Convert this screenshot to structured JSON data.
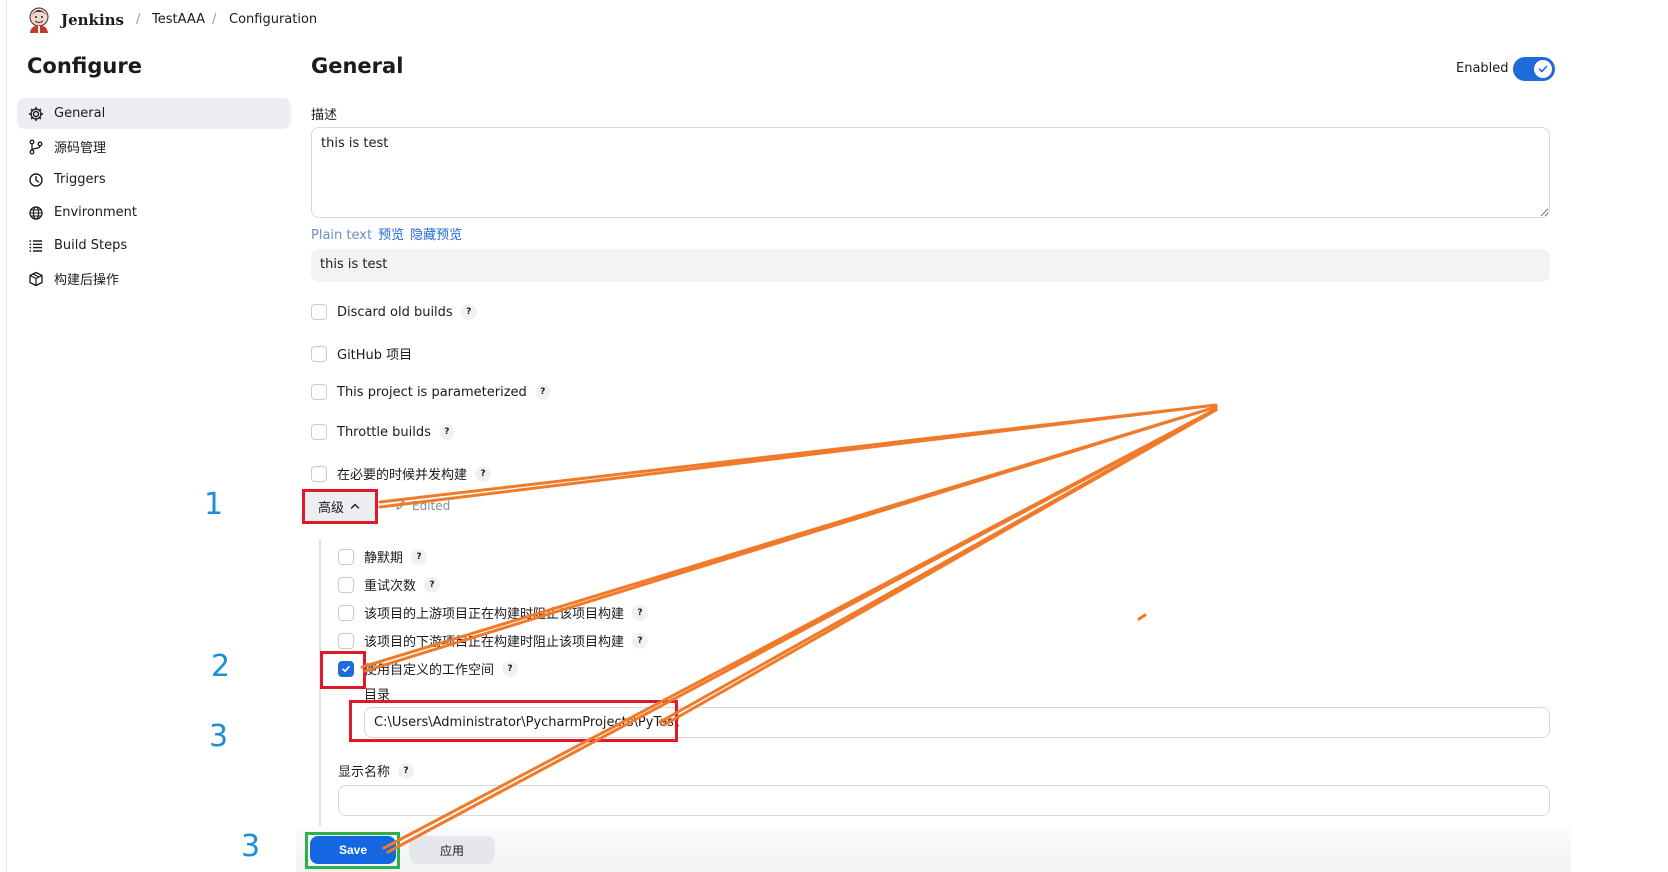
{
  "colors": {
    "accent": "#1e6bdc",
    "link": "#1e6bdc",
    "annotation_red": "#e0192a",
    "annotation_green": "#2db24a",
    "annotation_orange": "#f07a2a",
    "annotation_number": "#1a8fd8"
  },
  "breadcrumb": {
    "brand": "Jenkins",
    "items": [
      "TestAAA",
      "Configuration"
    ],
    "separator": "/"
  },
  "sidebar": {
    "title": "Configure",
    "items": [
      {
        "label": "General",
        "icon": "gear-icon",
        "active": true
      },
      {
        "label": "源码管理",
        "icon": "branch-icon"
      },
      {
        "label": "Triggers",
        "icon": "clock-icon"
      },
      {
        "label": "Environment",
        "icon": "globe-icon"
      },
      {
        "label": "Build Steps",
        "icon": "list-icon"
      },
      {
        "label": "构建后操作",
        "icon": "package-icon"
      }
    ]
  },
  "main": {
    "title": "General",
    "enabled_label": "Enabled",
    "enabled": true,
    "description_label": "描述",
    "description_value": "this is test",
    "format_links": [
      "Plain text",
      "预览",
      "隐藏预览"
    ],
    "preview_text": "this is test",
    "options": [
      {
        "label": "Discard old builds",
        "help": "?"
      },
      {
        "label": "GitHub 项目"
      },
      {
        "label": "This project is parameterized",
        "help": "?"
      },
      {
        "label": "Throttle builds",
        "help": "?"
      },
      {
        "label": "在必要的时候并发构建",
        "help": "?"
      }
    ],
    "advanced": {
      "button_label": "高级",
      "edited_label": "Edited",
      "options": [
        {
          "label": "静默期",
          "help": "?",
          "checked": false
        },
        {
          "label": "重试次数",
          "help": "?",
          "checked": false
        },
        {
          "label": "该项目的上游项目正在构建时阻止该项目构建",
          "help": "?",
          "checked": false
        },
        {
          "label": "该项目的下游项目正在构建时阻止该项目构建",
          "help": "?",
          "checked": false
        },
        {
          "label": "使用自定义的工作空间",
          "help": "?",
          "checked": true
        }
      ],
      "directory_label": "目录",
      "directory_value": "C:\\Users\\Administrator\\PycharmProjects\\PyTest",
      "display_name_label": "显示名称",
      "display_name_help": "?",
      "display_name_value": ""
    },
    "buttons": {
      "save": "Save",
      "apply": "应用"
    }
  },
  "annotations": {
    "numbers": [
      "1",
      "2",
      "3",
      "3"
    ]
  }
}
